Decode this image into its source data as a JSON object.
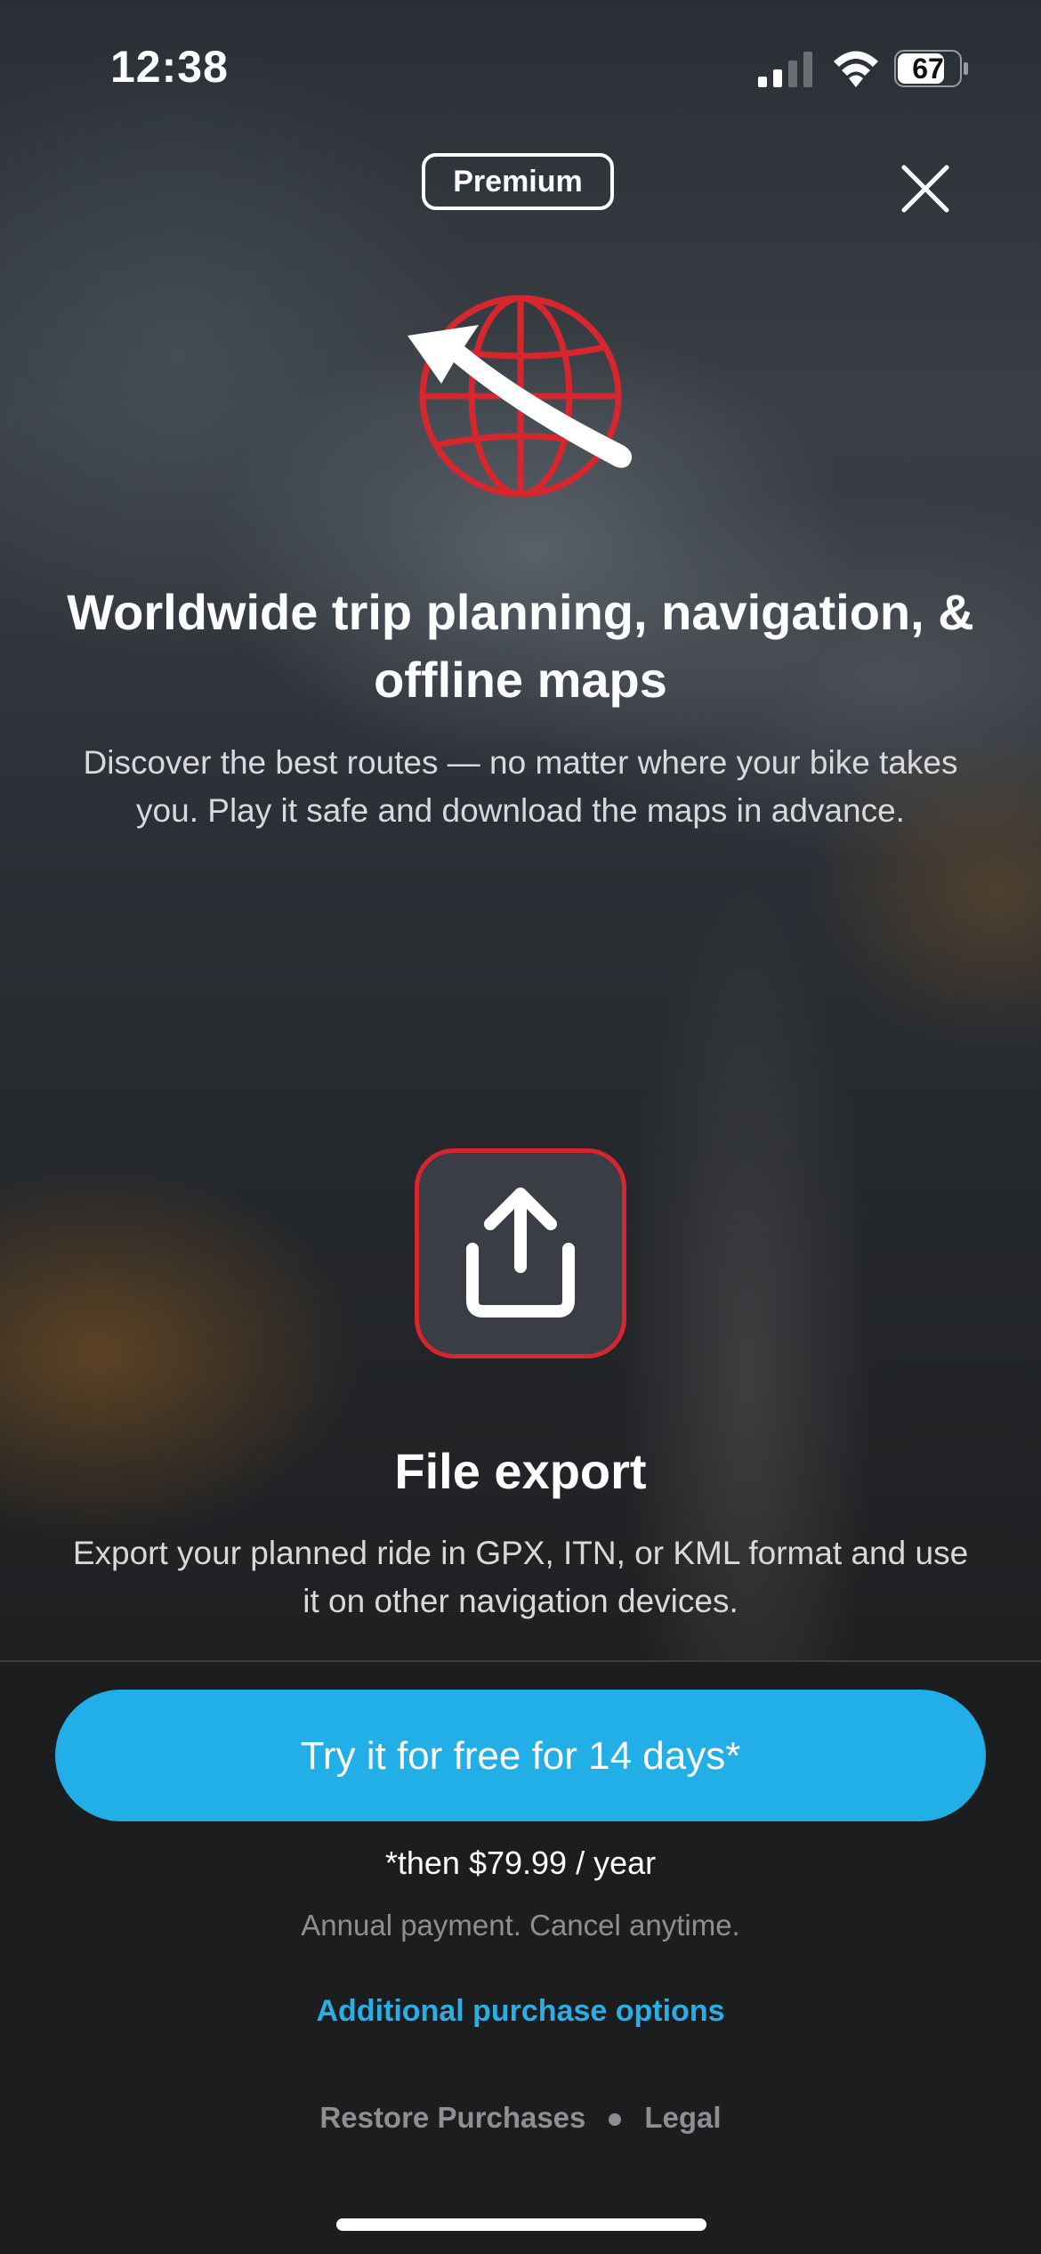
{
  "status_bar": {
    "time": "12:38",
    "battery_level": "67"
  },
  "header": {
    "badge_label": "Premium"
  },
  "features": [
    {
      "title": "Worldwide trip planning, navigation, & offline maps",
      "description": "Discover the best routes — no matter where your bike takes you. Play it safe and download the maps in advance."
    },
    {
      "title": "File export",
      "description": "Export your planned ride in GPX, ITN, or KML format and use it on other navigation devices."
    }
  ],
  "offer": {
    "cta_label": "Try it for free for 14 days*",
    "price_note": "*then $79.99 / year",
    "payment_note": "Annual payment. Cancel anytime.",
    "additional_options": "Additional purchase options"
  },
  "footer": {
    "restore": "Restore Purchases",
    "legal": "Legal"
  },
  "colors": {
    "accent_red": "#d8262e",
    "accent_blue": "#22aee6",
    "panel_bg": "#1c1d1f"
  }
}
